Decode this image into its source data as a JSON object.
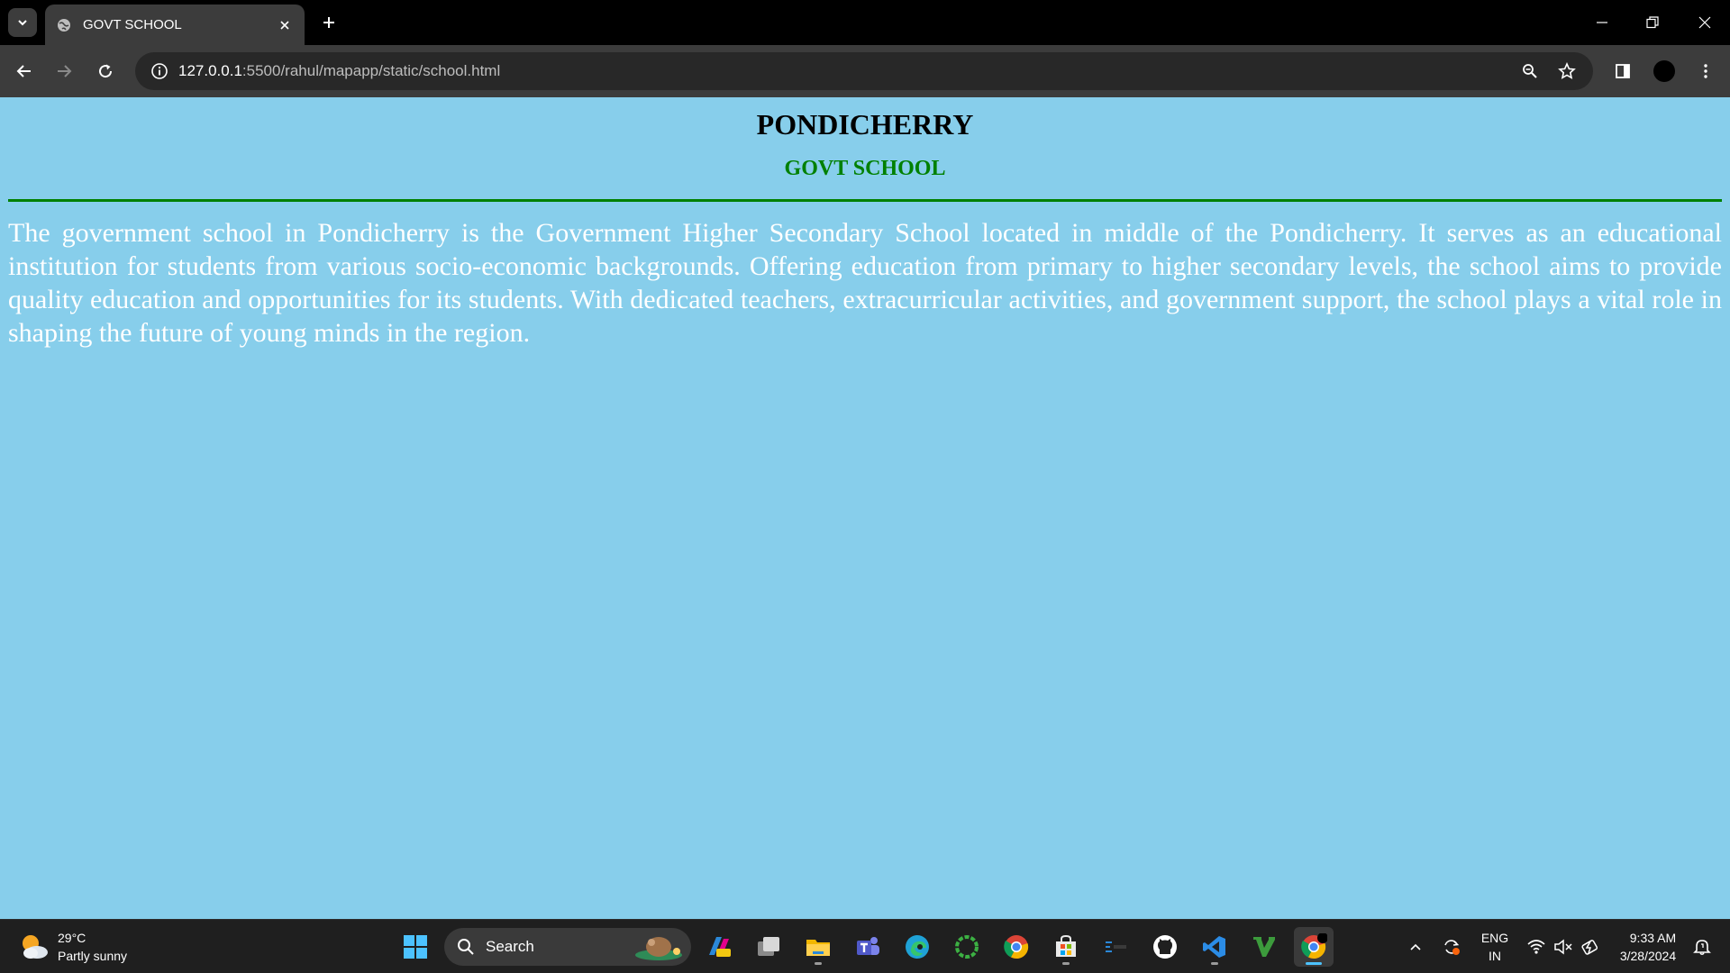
{
  "browser": {
    "tab": {
      "title": "GOVT SCHOOL"
    },
    "address": {
      "url_host": "127.0.0.1",
      "url_rest": ":5500/rahul/mapapp/static/school.html"
    }
  },
  "page": {
    "heading": "PONDICHERRY",
    "subheading": "GOVT SCHOOL",
    "paragraph": "The government school in Pondicherry is the Government Higher Secondary School located in middle of the Pondicherry. It serves as an educational institution for students from various socio-economic backgrounds. Offering education from primary to higher secondary levels, the school aims to provide quality education and opportunities for its students. With dedicated teachers, extracurricular activities, and government support, the school plays a vital role in shaping the future of young minds in the region.",
    "background_color": "#87ceeb",
    "accent_color": "#008000"
  },
  "taskbar": {
    "weather": {
      "temperature": "29°C",
      "condition": "Partly sunny"
    },
    "search": {
      "label": "Search"
    },
    "language": {
      "line1": "ENG",
      "line2": "IN"
    },
    "clock": {
      "time": "9:33 AM",
      "date": "3/28/2024"
    },
    "apps": [
      "start-menu",
      "search",
      "copilot",
      "task-view",
      "file-explorer",
      "teams",
      "edge",
      "sync-app",
      "chrome",
      "microsoft-store",
      "terminal-app",
      "github-desktop",
      "vscode",
      "vim",
      "chrome-active"
    ]
  }
}
